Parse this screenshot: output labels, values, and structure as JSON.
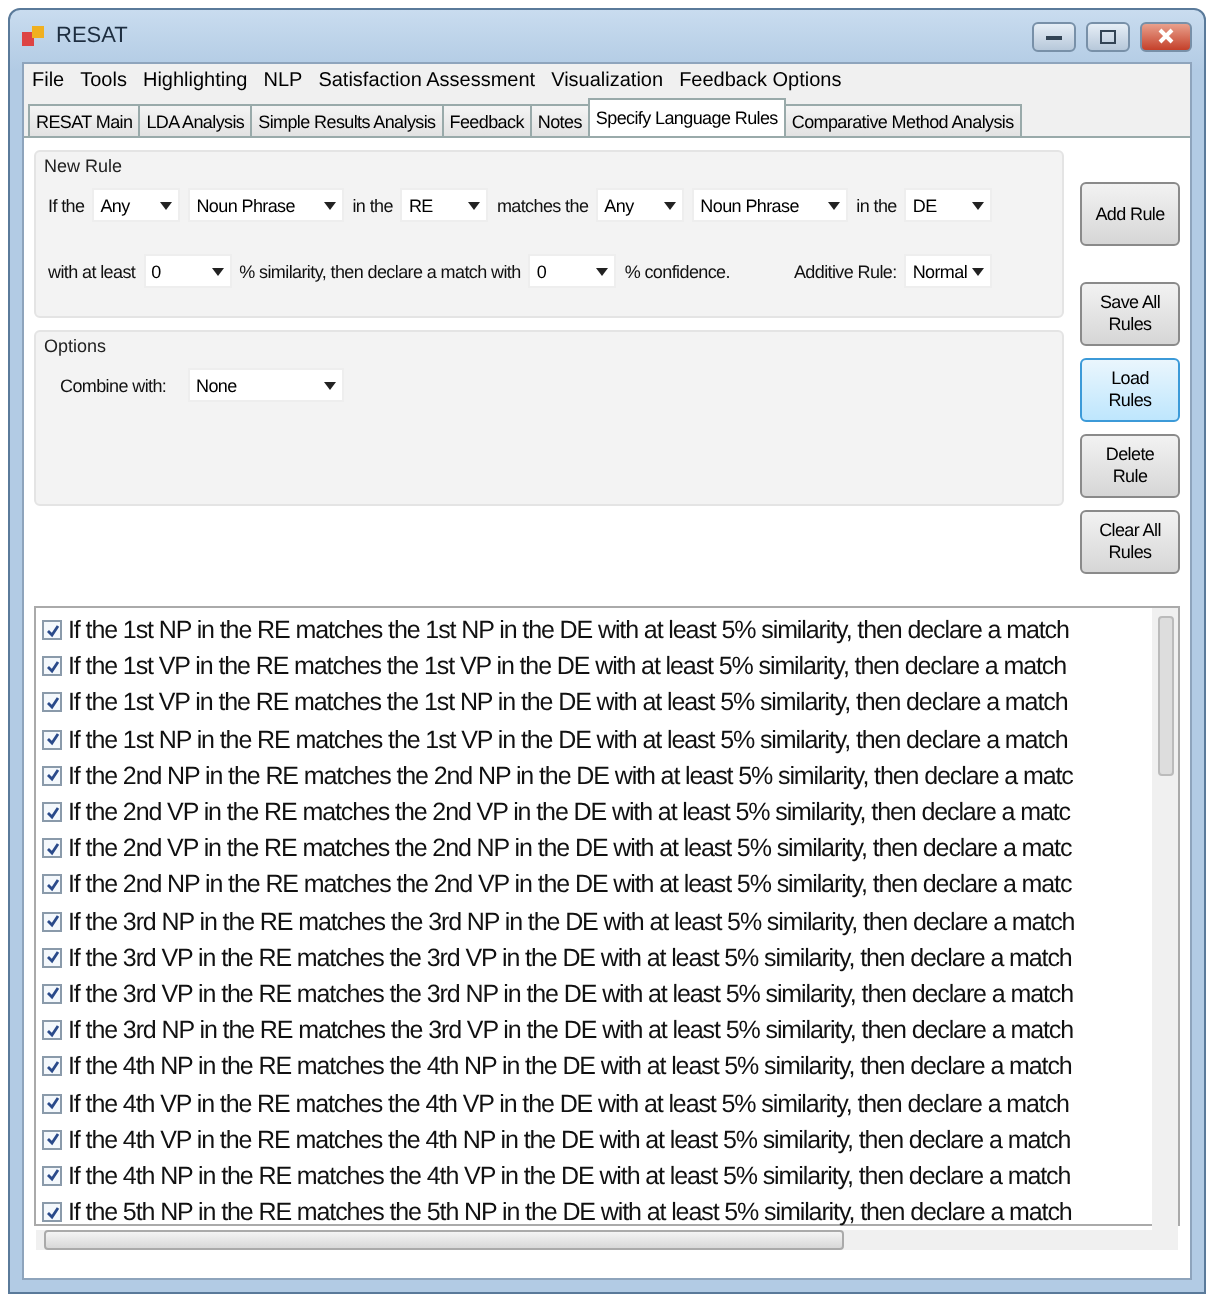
{
  "window": {
    "title": "RESAT"
  },
  "menu": [
    "File",
    "Tools",
    "Highlighting",
    "NLP",
    "Satisfaction Assessment",
    "Visualization",
    "Feedback Options"
  ],
  "tabs": [
    {
      "label": "RESAT Main",
      "selected": false
    },
    {
      "label": "LDA Analysis",
      "selected": false
    },
    {
      "label": "Simple Results Analysis",
      "selected": false
    },
    {
      "label": "Feedback",
      "selected": false
    },
    {
      "label": "Notes",
      "selected": false
    },
    {
      "label": "Specify Language Rules",
      "selected": true
    },
    {
      "label": "Comparative Method Analysis",
      "selected": false
    }
  ],
  "new_rule": {
    "title": "New Rule",
    "lines": [
      [
        {
          "kind": "text",
          "text": "If the"
        },
        {
          "kind": "combo",
          "value": "Any"
        },
        {
          "kind": "longcombo",
          "value": "Noun Phrase"
        },
        {
          "kind": "text",
          "text": "in the"
        },
        {
          "kind": "combo",
          "value": "RE"
        },
        {
          "kind": "text",
          "text": "matches the"
        },
        {
          "kind": "combo",
          "value": "Any"
        },
        {
          "kind": "longcombo",
          "value": "Noun Phrase"
        },
        {
          "kind": "text",
          "text": "in the"
        },
        {
          "kind": "combo",
          "value": "DE"
        }
      ],
      [
        {
          "kind": "text",
          "text": "with at least"
        },
        {
          "kind": "combo",
          "value": "0"
        },
        {
          "kind": "text",
          "text": "% similarity, then declare a match with"
        },
        {
          "kind": "combo",
          "value": "0"
        },
        {
          "kind": "text",
          "text": "% confidence."
        },
        {
          "kind": "gap"
        },
        {
          "kind": "text",
          "text": "Additive Rule:"
        },
        {
          "kind": "combo",
          "value": "Normal"
        }
      ]
    ]
  },
  "options": {
    "title": "Options",
    "label": "Combine with:",
    "value": "None"
  },
  "buttons": [
    {
      "label": "Add Rule",
      "focused": false
    },
    {
      "label": "Save All Rules",
      "focused": false
    },
    {
      "label": "Load Rules",
      "focused": true
    },
    {
      "label": "Delete Rule",
      "focused": false
    },
    {
      "label": "Clear All Rules",
      "focused": false
    }
  ],
  "rules": [
    {
      "text": "If the 1st NP in the RE matches the 1st NP in the DE with at least 5% similarity, then declare a match",
      "checked": true
    },
    {
      "text": "If the 1st VP in the RE matches the 1st VP in the DE with at least 5% similarity, then declare a match",
      "checked": true
    },
    {
      "text": "If the 1st VP in the RE matches the 1st NP in the DE with at least 5% similarity, then declare a match",
      "checked": true
    },
    {
      "text": "If the 1st NP in the RE matches the 1st VP in the DE with at least 5% similarity, then declare a match",
      "checked": true
    },
    {
      "text": "If the 2nd NP in the RE matches the 2nd NP in the DE with at least 5% similarity, then declare a matc",
      "checked": true
    },
    {
      "text": "If the 2nd VP in the RE matches the 2nd VP in the DE with at least 5% similarity, then declare a matc",
      "checked": true
    },
    {
      "text": "If the 2nd VP in the RE matches the 2nd NP in the DE with at least 5% similarity, then declare a matc",
      "checked": true
    },
    {
      "text": "If the 2nd NP in the RE matches the 2nd VP in the DE with at least 5% similarity, then declare a matc",
      "checked": true
    },
    {
      "text": "If the 3rd NP in the RE matches the 3rd NP in the DE with at least 5% similarity, then declare a match",
      "checked": true
    },
    {
      "text": "If the 3rd VP in the RE matches the 3rd VP in the DE with at least 5% similarity, then declare a match",
      "checked": true
    },
    {
      "text": "If the 3rd VP in the RE matches the 3rd NP in the DE with at least 5% similarity, then declare a match",
      "checked": true
    },
    {
      "text": "If the 3rd NP in the RE matches the 3rd VP in the DE with at least 5% similarity, then declare a match",
      "checked": true
    },
    {
      "text": "If the 4th NP in the RE matches the 4th NP in the DE with at least 5% similarity, then declare a match",
      "checked": true
    },
    {
      "text": "If the 4th VP in the RE matches the 4th VP in the DE with at least 5% similarity, then declare a match",
      "checked": true
    },
    {
      "text": "If the 4th VP in the RE matches the 4th NP in the DE with at least 5% similarity, then declare a match",
      "checked": true
    },
    {
      "text": "If the 4th NP in the RE matches the 4th VP in the DE with at least 5% similarity, then declare a match",
      "checked": true
    },
    {
      "text": "If the 5th NP in the RE matches the 5th NP in the DE with at least 5% similarity, then declare a match",
      "checked": true
    }
  ]
}
